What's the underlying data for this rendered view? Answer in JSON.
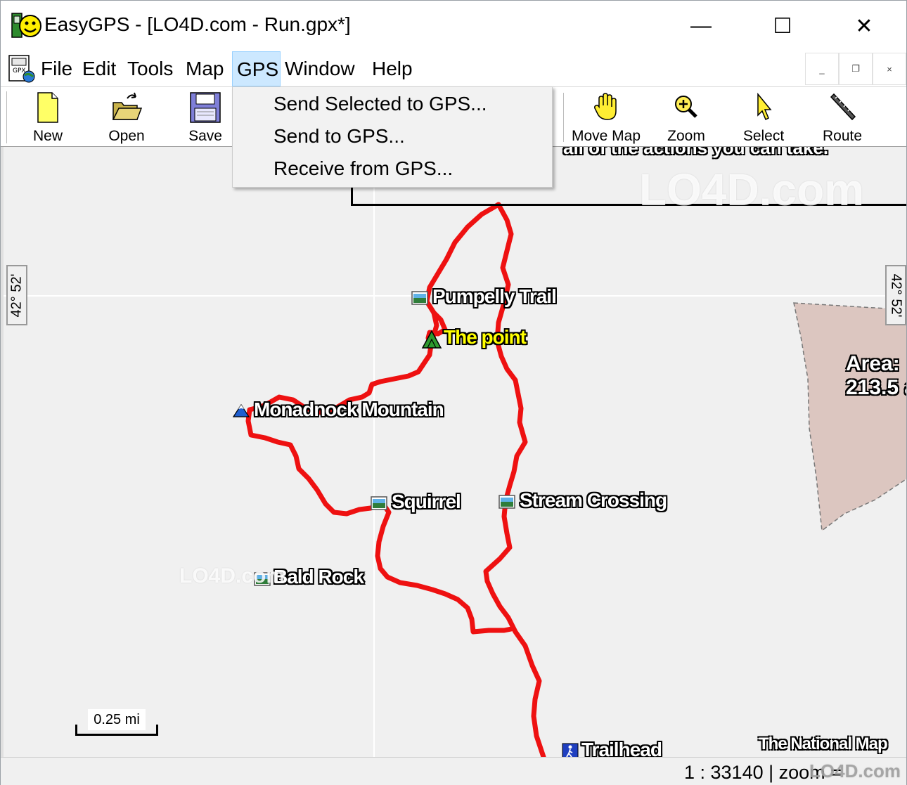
{
  "window": {
    "title": "EasyGPS - [LO4D.com - Run.gpx*]",
    "controls": {
      "minimize": "—",
      "maximize": "☐",
      "close": "✕"
    }
  },
  "menubar": {
    "items": [
      {
        "label": "File"
      },
      {
        "label": "Edit"
      },
      {
        "label": "Tools"
      },
      {
        "label": "Map"
      },
      {
        "label": "GPS",
        "active": true
      },
      {
        "label": "Window"
      },
      {
        "label": "Help"
      }
    ],
    "mdi": {
      "minimize": "_",
      "restore": "❐",
      "close": "×"
    }
  },
  "gps_menu": {
    "items": [
      {
        "label": "Send Selected to GPS..."
      },
      {
        "label": "Send to GPS..."
      },
      {
        "label": "Receive from GPS..."
      }
    ]
  },
  "toolbar": {
    "left": [
      {
        "label": "New",
        "icon": "new-file-icon"
      },
      {
        "label": "Open",
        "icon": "open-folder-icon"
      },
      {
        "label": "Save",
        "icon": "floppy-disk-icon"
      }
    ],
    "right": [
      {
        "label": "Move Map",
        "icon": "hand-icon"
      },
      {
        "label": "Zoom",
        "icon": "magnifier-icon"
      },
      {
        "label": "Select",
        "icon": "pointer-icon"
      },
      {
        "label": "Route",
        "icon": "ruler-icon"
      }
    ]
  },
  "map": {
    "latitude_left": "42° 52'",
    "latitude_right": "42° 52'",
    "callout_text": "all of the actions you can take.",
    "area_label_line1": "Area:",
    "area_label_line2": "213.5 a",
    "scale": "0.25 mi",
    "credit": "The National Map",
    "watermark": "LO4D.com",
    "waypoints": [
      {
        "name": "Pumpelly Trail",
        "icon": "photo-waypoint-icon"
      },
      {
        "name": "The point",
        "icon": "summit-icon",
        "highlight": true
      },
      {
        "name": "Monadnock Mountain",
        "icon": "mountain-icon"
      },
      {
        "name": "Squirrel",
        "icon": "photo-waypoint-icon"
      },
      {
        "name": "Stream Crossing",
        "icon": "photo-waypoint-icon"
      },
      {
        "name": "Bald Rock",
        "icon": "photo-waypoint-icon"
      },
      {
        "name": "Trailhead",
        "icon": "trailhead-icon"
      }
    ],
    "colors": {
      "track": "#ee1111",
      "area_fill": "#dcc6c0",
      "map_background": "#f0f0f0"
    }
  },
  "status": {
    "text": "1 : 33140 | zoom ="
  }
}
